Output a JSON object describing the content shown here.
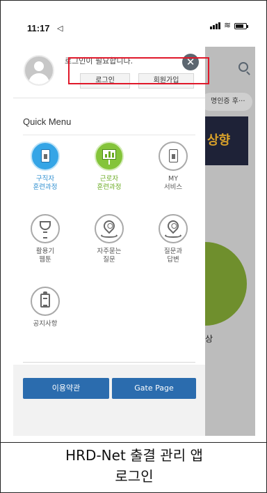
{
  "status_bar": {
    "time": "11:17",
    "location_glyph": "◁"
  },
  "drawer": {
    "login_message": "로그인이 필요합니다.",
    "login_button": "로그인",
    "signup_button": "회원가입",
    "close_glyph": "✕",
    "quick_menu_title": "Quick Menu",
    "items": [
      {
        "label": "구직자\n훈련과정",
        "icon": "job-seeker-doc-icon",
        "color": "#35a5e6"
      },
      {
        "label": "근로자\n훈련과정",
        "icon": "worker-presentation-icon",
        "color": "#84c43a"
      },
      {
        "label": "MY\n서비스",
        "icon": "my-service-doc-icon",
        "color": "#a9a9a9"
      },
      {
        "label": "활용기\n웹툰",
        "icon": "trophy-icon",
        "color": "#a9a9a9"
      },
      {
        "label": "자주묻는\n질문",
        "icon": "location-pin-icon",
        "color": "#a9a9a9"
      },
      {
        "label": "질문과\n답변",
        "icon": "location-pin-icon",
        "color": "#a9a9a9"
      },
      {
        "label": "공지사항",
        "icon": "clipboard-icon",
        "color": "#a9a9a9"
      }
    ],
    "terms_button": "이용약관",
    "gate_button": "Gate Page"
  },
  "background_app": {
    "chip_text": "명인증 후···",
    "banner_text": "상향",
    "text_fragment": "상"
  },
  "caption": {
    "line1": "HRD-Net 출결 관리 앱",
    "line2": "로그인"
  },
  "colors": {
    "primary_button": "#2b6cae",
    "highlight_box": "#e0182a"
  }
}
